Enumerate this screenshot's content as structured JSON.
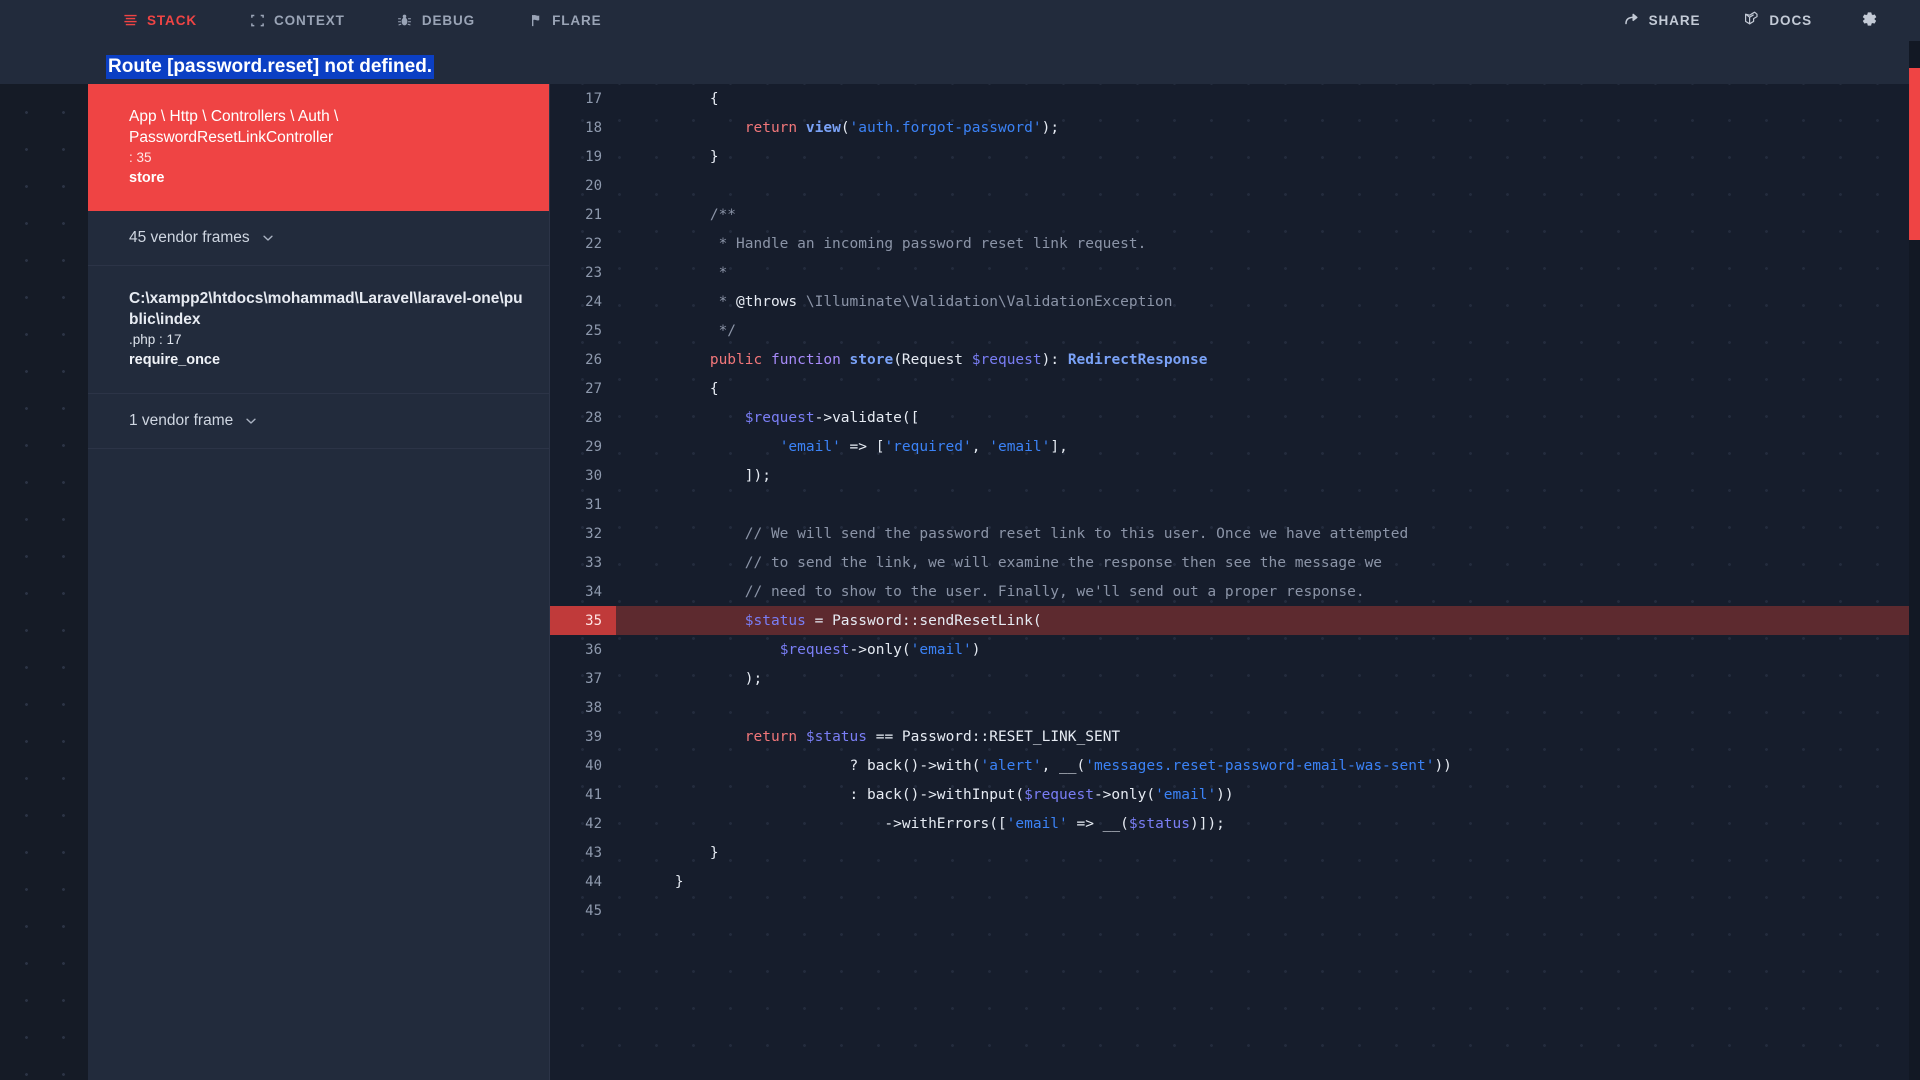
{
  "header": {
    "tabs": [
      {
        "label": "STACK",
        "icon": "stack-icon",
        "active": true
      },
      {
        "label": "CONTEXT",
        "icon": "context-icon",
        "active": false
      },
      {
        "label": "DEBUG",
        "icon": "bug-icon",
        "active": false
      },
      {
        "label": "FLARE",
        "icon": "flare-icon",
        "active": false
      }
    ],
    "share_label": "SHARE",
    "share_icon": "share-icon",
    "docs_label": "DOCS",
    "docs_icon": "laravel-icon",
    "settings_icon": "gear-icon",
    "accent_color": "#ef4444",
    "bg_color": "#222B3C"
  },
  "exception": {
    "title": "Route [password.reset] not defined.",
    "selection_color": "#0b3fc4"
  },
  "stack": {
    "frames": [
      {
        "class": "App \\ Http \\ Controllers \\ Auth \\ PasswordResetLinkController",
        "line": ": 35",
        "method": "store",
        "selected": true
      },
      {
        "file": "C:\\xampp2\\htdocs\\mohammad\\Laravel\\laravel-one\\public\\index",
        "line": ".php : 17",
        "method": "require_once",
        "selected": false
      }
    ],
    "vendor_groups": [
      {
        "label": "45 vendor frames",
        "icon": "chevron-down-icon"
      },
      {
        "label": "1 vendor frame",
        "icon": "chevron-down-icon"
      }
    ]
  },
  "code": {
    "highlight_line": 35,
    "highlight_bg": "#5d2a2f",
    "highlight_gutter": "#c03a3a",
    "lines": [
      {
        "n": 17,
        "tokens": [
          {
            "t": "        {",
            "c": "plain"
          }
        ]
      },
      {
        "n": 18,
        "tokens": [
          {
            "t": "            ",
            "c": "plain"
          },
          {
            "t": "return",
            "c": "k"
          },
          {
            "t": " ",
            "c": "plain"
          },
          {
            "t": "view",
            "c": "fn"
          },
          {
            "t": "(",
            "c": "plain"
          },
          {
            "t": "'auth.forgot-password'",
            "c": "str"
          },
          {
            "t": ");",
            "c": "plain"
          }
        ]
      },
      {
        "n": 19,
        "tokens": [
          {
            "t": "        }",
            "c": "plain"
          }
        ]
      },
      {
        "n": 20,
        "tokens": [
          {
            "t": "",
            "c": "plain"
          }
        ]
      },
      {
        "n": 21,
        "tokens": [
          {
            "t": "        /**",
            "c": "cm"
          }
        ]
      },
      {
        "n": 22,
        "tokens": [
          {
            "t": "         * Handle an incoming password reset link request.",
            "c": "cm"
          }
        ]
      },
      {
        "n": 23,
        "tokens": [
          {
            "t": "         *",
            "c": "cm"
          }
        ]
      },
      {
        "n": 24,
        "tokens": [
          {
            "t": "         * ",
            "c": "cm"
          },
          {
            "t": "@throws",
            "c": "plain"
          },
          {
            "t": " \\Illuminate\\Validation\\ValidationException",
            "c": "cm"
          }
        ]
      },
      {
        "n": 25,
        "tokens": [
          {
            "t": "         */",
            "c": "cm"
          }
        ]
      },
      {
        "n": 26,
        "tokens": [
          {
            "t": "        ",
            "c": "plain"
          },
          {
            "t": "public",
            "c": "k"
          },
          {
            "t": " ",
            "c": "plain"
          },
          {
            "t": "function",
            "c": "kf"
          },
          {
            "t": " ",
            "c": "plain"
          },
          {
            "t": "store",
            "c": "fn"
          },
          {
            "t": "(Request ",
            "c": "plain"
          },
          {
            "t": "$request",
            "c": "var"
          },
          {
            "t": "): ",
            "c": "plain"
          },
          {
            "t": "RedirectResponse",
            "c": "fn"
          }
        ]
      },
      {
        "n": 27,
        "tokens": [
          {
            "t": "        {",
            "c": "plain"
          }
        ]
      },
      {
        "n": 28,
        "tokens": [
          {
            "t": "            ",
            "c": "plain"
          },
          {
            "t": "$request",
            "c": "var"
          },
          {
            "t": "->",
            "c": "plain"
          },
          {
            "t": "validate",
            "c": "plain"
          },
          {
            "t": "([",
            "c": "plain"
          }
        ]
      },
      {
        "n": 29,
        "tokens": [
          {
            "t": "                ",
            "c": "plain"
          },
          {
            "t": "'email'",
            "c": "str"
          },
          {
            "t": " => [",
            "c": "plain"
          },
          {
            "t": "'required'",
            "c": "str"
          },
          {
            "t": ", ",
            "c": "plain"
          },
          {
            "t": "'email'",
            "c": "str"
          },
          {
            "t": "],",
            "c": "plain"
          }
        ]
      },
      {
        "n": 30,
        "tokens": [
          {
            "t": "            ]);",
            "c": "plain"
          }
        ]
      },
      {
        "n": 31,
        "tokens": [
          {
            "t": "",
            "c": "plain"
          }
        ]
      },
      {
        "n": 32,
        "tokens": [
          {
            "t": "            // We will send the password reset link to this user. Once we have attempted",
            "c": "cm"
          }
        ]
      },
      {
        "n": 33,
        "tokens": [
          {
            "t": "            // to send the link, we will examine the response then see the message we",
            "c": "cm"
          }
        ]
      },
      {
        "n": 34,
        "tokens": [
          {
            "t": "            // need to show to the user. Finally, we'll send out a proper response.",
            "c": "cm"
          }
        ]
      },
      {
        "n": 35,
        "tokens": [
          {
            "t": "            ",
            "c": "plain"
          },
          {
            "t": "$status",
            "c": "var"
          },
          {
            "t": " = Password::sendResetLink(",
            "c": "plain"
          }
        ],
        "hl": true
      },
      {
        "n": 36,
        "tokens": [
          {
            "t": "                ",
            "c": "plain"
          },
          {
            "t": "$request",
            "c": "var"
          },
          {
            "t": "->only(",
            "c": "plain"
          },
          {
            "t": "'email'",
            "c": "str"
          },
          {
            "t": ")",
            "c": "plain"
          }
        ]
      },
      {
        "n": 37,
        "tokens": [
          {
            "t": "            );",
            "c": "plain"
          }
        ]
      },
      {
        "n": 38,
        "tokens": [
          {
            "t": "",
            "c": "plain"
          }
        ]
      },
      {
        "n": 39,
        "tokens": [
          {
            "t": "            ",
            "c": "plain"
          },
          {
            "t": "return",
            "c": "k"
          },
          {
            "t": " ",
            "c": "plain"
          },
          {
            "t": "$status",
            "c": "var"
          },
          {
            "t": " == Password::RESET_LINK_SENT",
            "c": "plain"
          }
        ]
      },
      {
        "n": 40,
        "tokens": [
          {
            "t": "                        ? back()->with(",
            "c": "plain"
          },
          {
            "t": "'alert'",
            "c": "str"
          },
          {
            "t": ", __(",
            "c": "plain"
          },
          {
            "t": "'messages.reset-password-email-was-sent'",
            "c": "str"
          },
          {
            "t": "))",
            "c": "plain"
          }
        ]
      },
      {
        "n": 41,
        "tokens": [
          {
            "t": "                        : back()->withInput(",
            "c": "plain"
          },
          {
            "t": "$request",
            "c": "var"
          },
          {
            "t": "->only(",
            "c": "plain"
          },
          {
            "t": "'email'",
            "c": "str"
          },
          {
            "t": "))",
            "c": "plain"
          }
        ]
      },
      {
        "n": 42,
        "tokens": [
          {
            "t": "                            ->withErrors([",
            "c": "plain"
          },
          {
            "t": "'email'",
            "c": "str"
          },
          {
            "t": " => __(",
            "c": "plain"
          },
          {
            "t": "$status",
            "c": "var"
          },
          {
            "t": ")]);",
            "c": "plain"
          }
        ]
      },
      {
        "n": 43,
        "tokens": [
          {
            "t": "        }",
            "c": "plain"
          }
        ]
      },
      {
        "n": 44,
        "tokens": [
          {
            "t": "    }",
            "c": "plain"
          }
        ]
      },
      {
        "n": 45,
        "tokens": [
          {
            "t": "",
            "c": "plain"
          }
        ]
      }
    ]
  },
  "scrollbar": {
    "thumb_color": "#ef4444",
    "track_color": "#121824"
  }
}
